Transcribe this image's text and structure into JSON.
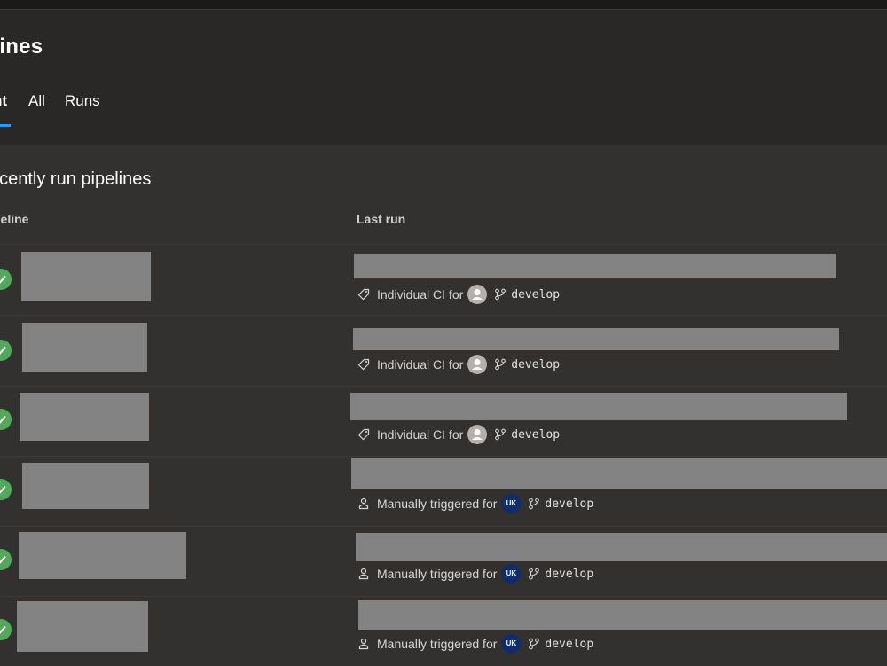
{
  "header": {
    "title": "elines",
    "tabs": [
      {
        "label": "nt",
        "selected": true
      },
      {
        "label": "All",
        "selected": false
      },
      {
        "label": "Runs",
        "selected": false
      }
    ]
  },
  "section": {
    "title": "ecently run pipelines"
  },
  "columns": {
    "pipeline": "peline",
    "last_run": "Last run"
  },
  "rows": [
    {
      "status": "succeeded",
      "reason": "Individual CI for",
      "reason_icon": "tag-icon",
      "avatar": "person-avatar",
      "avatar_initials": "",
      "branch": "develop"
    },
    {
      "status": "succeeded",
      "reason": "Individual CI for",
      "reason_icon": "tag-icon",
      "avatar": "person-avatar",
      "avatar_initials": "",
      "branch": "develop"
    },
    {
      "status": "succeeded",
      "reason": "Individual CI for",
      "reason_icon": "tag-icon",
      "avatar": "person-avatar",
      "avatar_initials": "",
      "branch": "develop"
    },
    {
      "status": "succeeded",
      "reason": "Manually triggered for",
      "reason_icon": "person-icon",
      "avatar": "initials-avatar",
      "avatar_initials": "UK",
      "branch": "develop"
    },
    {
      "status": "succeeded",
      "reason": "Manually triggered for",
      "reason_icon": "person-icon",
      "avatar": "initials-avatar",
      "avatar_initials": "UK",
      "branch": "develop"
    },
    {
      "status": "succeeded",
      "reason": "Manually triggered for",
      "reason_icon": "person-icon",
      "avatar": "initials-avatar",
      "avatar_initials": "UK",
      "branch": "develop"
    }
  ],
  "colors": {
    "background": "#323130",
    "header": "#292827",
    "success": "#54a75b",
    "accent": "#2899f5",
    "redacted": "#838383",
    "avatar_initials_bg": "#0f2d6b"
  }
}
